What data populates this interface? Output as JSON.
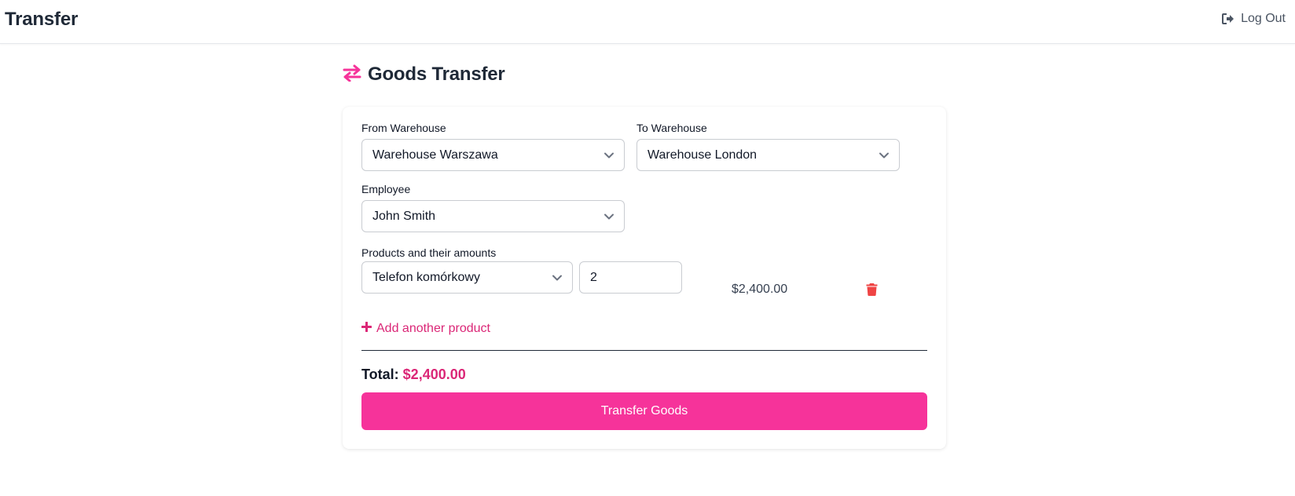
{
  "header": {
    "app_title": "Transfer",
    "logout_label": "Log Out",
    "logout_icon": "sign-out-icon"
  },
  "page": {
    "title": "Goods Transfer",
    "title_icon": "exchange-arrows-icon",
    "accent_color": "#db2777"
  },
  "form": {
    "from_warehouse": {
      "label": "From Warehouse",
      "value": "Warehouse Warszawa"
    },
    "to_warehouse": {
      "label": "To Warehouse",
      "value": "Warehouse London"
    },
    "employee": {
      "label": "Employee",
      "value": "John Smith"
    },
    "products": {
      "label": "Products and their amounts",
      "items": [
        {
          "product": "Telefon komórkowy",
          "quantity": "2",
          "line_total": "$2,400.00"
        }
      ],
      "add_label": "Add another product"
    },
    "total_label": "Total:",
    "total_value": "$2,400.00",
    "submit_label": "Transfer Goods",
    "submit_color": "#f6339a",
    "delete_color": "#ef4444"
  }
}
